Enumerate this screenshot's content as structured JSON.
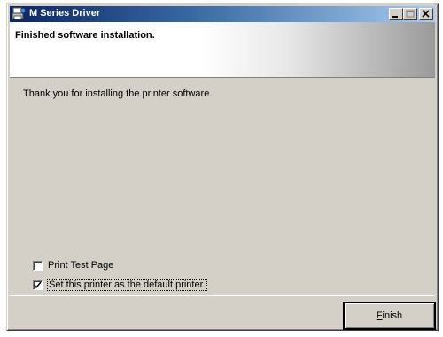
{
  "window": {
    "title": "M Series Driver",
    "accent_color": "#0a246a",
    "controls": {
      "minimize_icon": "minimize-icon",
      "maximize_icon": "maximize-icon",
      "close_icon": "close-icon"
    }
  },
  "header": {
    "title": "Finished software installation."
  },
  "body": {
    "message": "Thank you for installing the printer software."
  },
  "options": [
    {
      "label": "Print Test Page",
      "checked": false
    },
    {
      "label": "Set this printer as the default printer.",
      "checked": true
    }
  ],
  "footer": {
    "finish_label": "Finish"
  }
}
